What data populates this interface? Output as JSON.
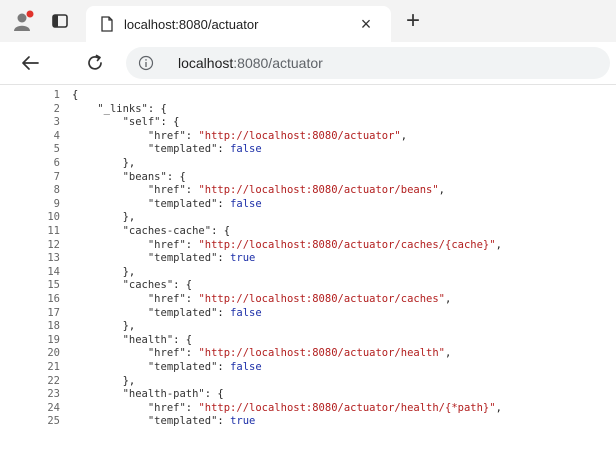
{
  "tab": {
    "title": "localhost:8080/actuator",
    "close_glyph": "×"
  },
  "new_tab_glyph": "+",
  "address": {
    "host": "localhost",
    "path": ":8080/actuator"
  },
  "icons": [
    "profile-icon",
    "tab-actions-icon",
    "page-icon",
    "close-icon",
    "new-tab-icon",
    "back-arrow-icon",
    "reload-icon",
    "info-icon"
  ],
  "colors": {
    "string": "#b21e1e",
    "boolean": "#1c2fa8",
    "tabstrip": "#f3f3f3"
  },
  "code": [
    {
      "n": "1",
      "t": "{"
    },
    {
      "n": "2",
      "t": "    \"_links\": {"
    },
    {
      "n": "3",
      "t": "        \"self\": {"
    },
    {
      "n": "4",
      "t": "            \"href\": \"http://localhost:8080/actuator\","
    },
    {
      "n": "5",
      "t": "            \"templated\": false"
    },
    {
      "n": "6",
      "t": "        },"
    },
    {
      "n": "7",
      "t": "        \"beans\": {"
    },
    {
      "n": "8",
      "t": "            \"href\": \"http://localhost:8080/actuator/beans\","
    },
    {
      "n": "9",
      "t": "            \"templated\": false"
    },
    {
      "n": "10",
      "t": "        },"
    },
    {
      "n": "11",
      "t": "        \"caches-cache\": {"
    },
    {
      "n": "12",
      "t": "            \"href\": \"http://localhost:8080/actuator/caches/{cache}\","
    },
    {
      "n": "13",
      "t": "            \"templated\": true"
    },
    {
      "n": "14",
      "t": "        },"
    },
    {
      "n": "15",
      "t": "        \"caches\": {"
    },
    {
      "n": "16",
      "t": "            \"href\": \"http://localhost:8080/actuator/caches\","
    },
    {
      "n": "17",
      "t": "            \"templated\": false"
    },
    {
      "n": "18",
      "t": "        },"
    },
    {
      "n": "19",
      "t": "        \"health\": {"
    },
    {
      "n": "20",
      "t": "            \"href\": \"http://localhost:8080/actuator/health\","
    },
    {
      "n": "21",
      "t": "            \"templated\": false"
    },
    {
      "n": "22",
      "t": "        },"
    },
    {
      "n": "23",
      "t": "        \"health-path\": {"
    },
    {
      "n": "24",
      "t": "            \"href\": \"http://localhost:8080/actuator/health/{*path}\","
    },
    {
      "n": "25",
      "t": "            \"templated\": true"
    }
  ]
}
